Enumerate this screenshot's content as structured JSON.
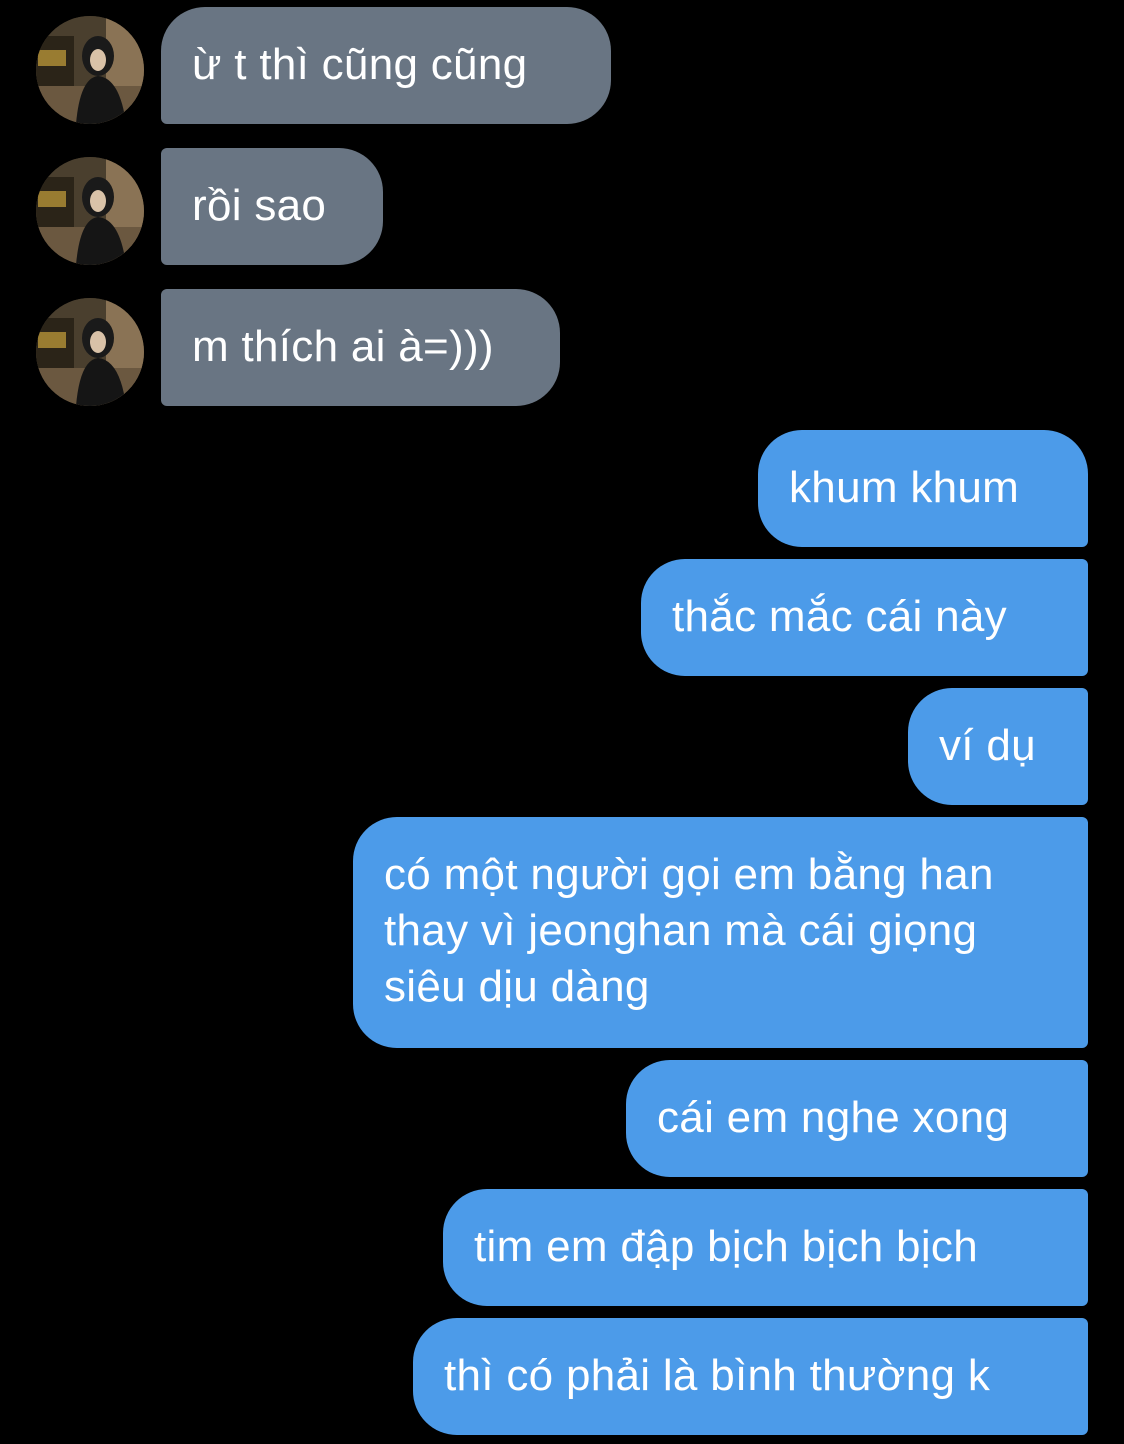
{
  "conversation": {
    "incoming": [
      {
        "text": "ừ t thì cũng cũng"
      },
      {
        "text": "rồi sao"
      },
      {
        "text": "m thích ai à=)))"
      }
    ],
    "outgoing": [
      {
        "text": "khum khum"
      },
      {
        "text": "thắc mắc cái này"
      },
      {
        "text": "ví dụ"
      },
      {
        "text": "có một người gọi em bằng han thay vì jeonghan mà cái giọng siêu dịu dàng"
      },
      {
        "text": "cái em nghe xong"
      },
      {
        "text": "tim em đập bịch bịch bịch"
      },
      {
        "text": "thì có phải là bình thường k"
      }
    ]
  },
  "colors": {
    "background": "#000000",
    "incoming_bubble": "#697583",
    "outgoing_bubble": "#4c9be9",
    "text": "#ffffff"
  },
  "icons": {
    "contact_avatar": "avatar"
  }
}
